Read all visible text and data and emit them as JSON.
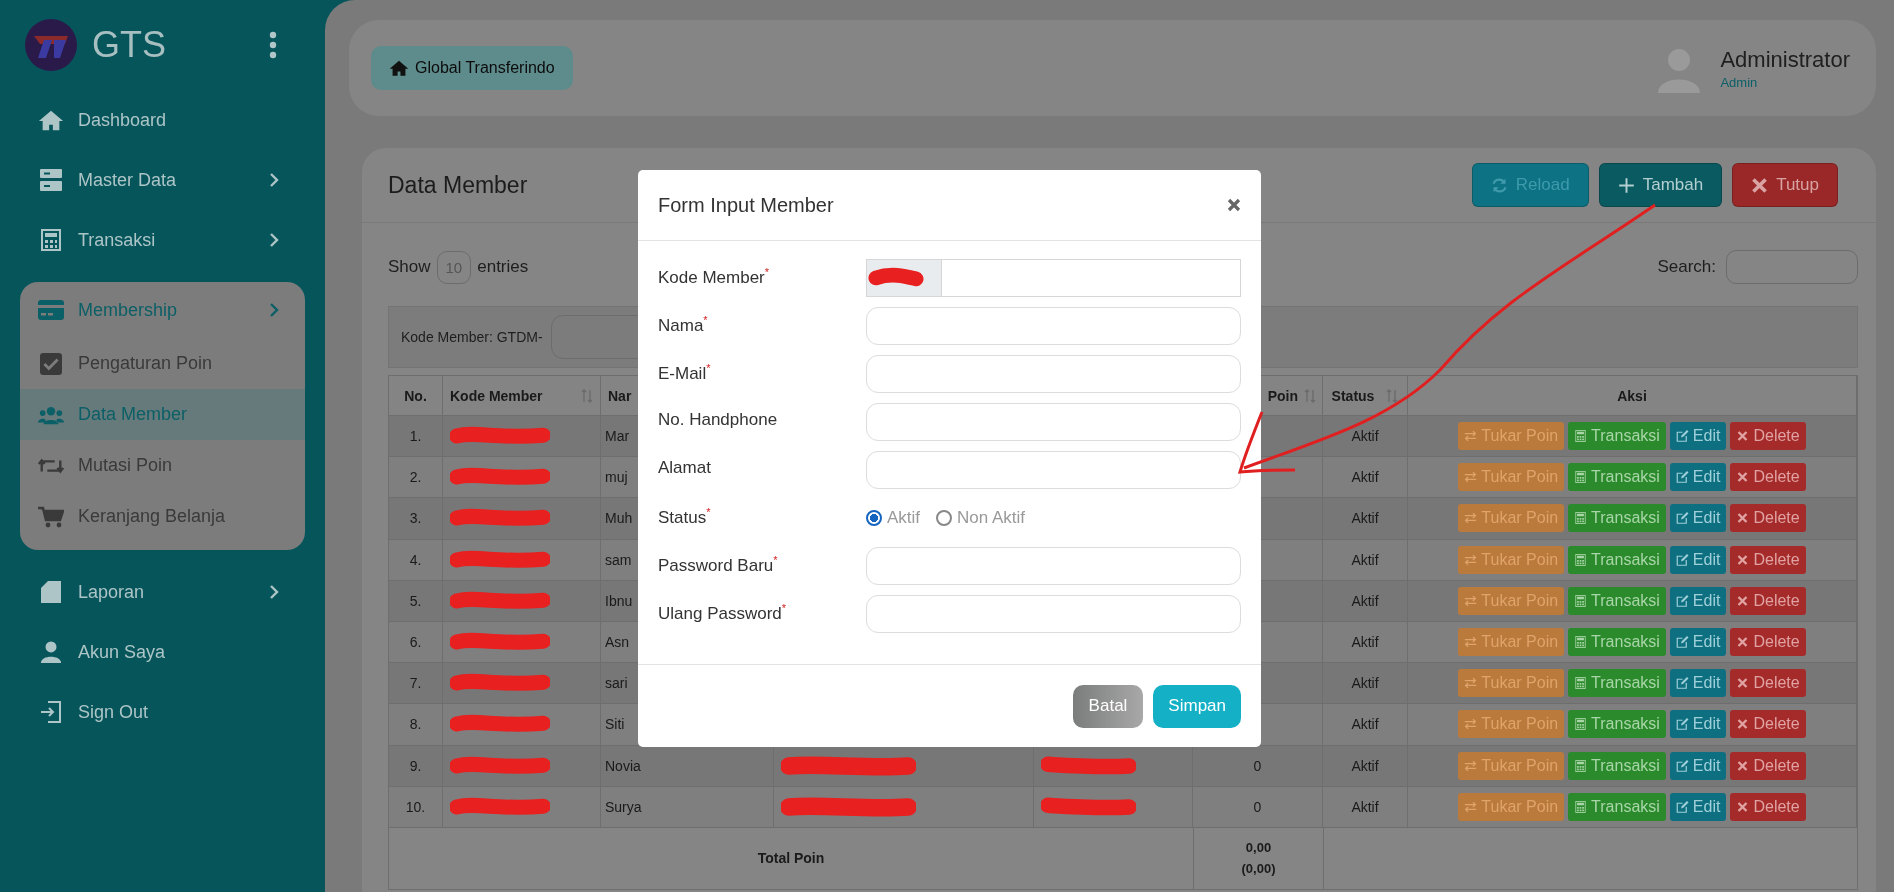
{
  "sidebar": {
    "logo_text": "GTS",
    "items": [
      {
        "label": "Dashboard",
        "submenu": false
      },
      {
        "label": "Master Data",
        "submenu": true
      },
      {
        "label": "Transaksi",
        "submenu": true
      },
      {
        "label": "Membership",
        "submenu": true,
        "expanded": true,
        "children": [
          {
            "label": "Pengaturan Poin",
            "selected": false
          },
          {
            "label": "Data Member",
            "selected": true
          },
          {
            "label": "Mutasi Poin",
            "selected": false
          },
          {
            "label": "Keranjang Belanja",
            "selected": false
          }
        ]
      },
      {
        "label": "Laporan",
        "submenu": true
      },
      {
        "label": "Akun Saya",
        "submenu": false
      },
      {
        "label": "Sign Out",
        "submenu": false
      }
    ]
  },
  "header": {
    "breadcrumb": "Global Transferindo",
    "user": {
      "name": "Administrator",
      "role": "Admin"
    }
  },
  "card": {
    "title": "Data Member",
    "buttons": [
      {
        "kind": "reload",
        "label": "Reload"
      },
      {
        "kind": "add",
        "label": "Tambah"
      },
      {
        "kind": "close",
        "label": "Tutup"
      }
    ]
  },
  "length": {
    "before": "Show",
    "value": "10",
    "after": "entries"
  },
  "search": {
    "label": "Search:"
  },
  "filter": {
    "label": "Kode Member: GTDM-"
  },
  "table": {
    "columns": [
      {
        "label": "No.",
        "sortable": false
      },
      {
        "label": "Kode Member",
        "sortable": true
      },
      {
        "label": "Nar",
        "sortable": false
      },
      {
        "label": "Poin",
        "sortable": true
      },
      {
        "label": "Status",
        "sortable": true
      },
      {
        "label": "Aksi",
        "sortable": false
      }
    ],
    "rows": [
      {
        "no": "1.",
        "nama": "Mar",
        "status": "Aktif",
        "actions": [
          {
            "kind": "exchange",
            "label": "Tukar Poin"
          },
          {
            "kind": "transaction",
            "label": "Transaksi"
          },
          {
            "kind": "edit",
            "label": "Edit"
          },
          {
            "kind": "delete",
            "label": "Delete"
          }
        ]
      },
      {
        "no": "2.",
        "nama": "muj",
        "status": "Aktif",
        "actions": [
          {
            "kind": "exchange",
            "label": "Tukar Poin"
          },
          {
            "kind": "transaction",
            "label": "Transaksi"
          },
          {
            "kind": "edit",
            "label": "Edit"
          },
          {
            "kind": "delete",
            "label": "Delete"
          }
        ]
      },
      {
        "no": "3.",
        "nama": "Muh",
        "status": "Aktif",
        "actions": [
          {
            "kind": "exchange",
            "label": "Tukar Poin"
          },
          {
            "kind": "transaction",
            "label": "Transaksi"
          },
          {
            "kind": "edit",
            "label": "Edit"
          },
          {
            "kind": "delete",
            "label": "Delete"
          }
        ]
      },
      {
        "no": "4.",
        "nama": "sam",
        "status": "Aktif",
        "actions": [
          {
            "kind": "exchange",
            "label": "Tukar Poin"
          },
          {
            "kind": "transaction",
            "label": "Transaksi"
          },
          {
            "kind": "edit",
            "label": "Edit"
          },
          {
            "kind": "delete",
            "label": "Delete"
          }
        ]
      },
      {
        "no": "5.",
        "nama": "Ibnu",
        "status": "Aktif",
        "actions": [
          {
            "kind": "exchange",
            "label": "Tukar Poin"
          },
          {
            "kind": "transaction",
            "label": "Transaksi"
          },
          {
            "kind": "edit",
            "label": "Edit"
          },
          {
            "kind": "delete",
            "label": "Delete"
          }
        ]
      },
      {
        "no": "6.",
        "nama": "Asn",
        "status": "Aktif",
        "actions": [
          {
            "kind": "exchange",
            "label": "Tukar Poin"
          },
          {
            "kind": "transaction",
            "label": "Transaksi"
          },
          {
            "kind": "edit",
            "label": "Edit"
          },
          {
            "kind": "delete",
            "label": "Delete"
          }
        ]
      },
      {
        "no": "7.",
        "nama": "sari",
        "status": "Aktif",
        "actions": [
          {
            "kind": "exchange",
            "label": "Tukar Poin"
          },
          {
            "kind": "transaction",
            "label": "Transaksi"
          },
          {
            "kind": "edit",
            "label": "Edit"
          },
          {
            "kind": "delete",
            "label": "Delete"
          }
        ]
      },
      {
        "no": "8.",
        "nama": "Siti",
        "status": "Aktif",
        "actions": [
          {
            "kind": "exchange",
            "label": "Tukar Poin"
          },
          {
            "kind": "transaction",
            "label": "Transaksi"
          },
          {
            "kind": "edit",
            "label": "Edit"
          },
          {
            "kind": "delete",
            "label": "Delete"
          }
        ]
      },
      {
        "no": "9.",
        "nama": "Novia",
        "poin": "0",
        "status": "Aktif",
        "actions": [
          {
            "kind": "exchange",
            "label": "Tukar Poin"
          },
          {
            "kind": "transaction",
            "label": "Transaksi"
          },
          {
            "kind": "edit",
            "label": "Edit"
          },
          {
            "kind": "delete",
            "label": "Delete"
          }
        ]
      },
      {
        "no": "10.",
        "nama": "Surya",
        "poin": "0",
        "status": "Aktif",
        "actions": [
          {
            "kind": "exchange",
            "label": "Tukar Poin"
          },
          {
            "kind": "transaction",
            "label": "Transaksi"
          },
          {
            "kind": "edit",
            "label": "Edit"
          },
          {
            "kind": "delete",
            "label": "Delete"
          }
        ]
      }
    ],
    "total": {
      "label": "Total Poin",
      "value": "0,00",
      "sub": "(0,00)"
    }
  },
  "modal": {
    "title": "Form Input Member",
    "fields": [
      {
        "label": "Kode Member$^{*}$",
        "kind": "prefixed"
      },
      {
        "label": "Nama$^{*}$",
        "kind": "text"
      },
      {
        "label": "E-Mail$^{*}$",
        "kind": "text"
      },
      {
        "label": "No. Handphone",
        "kind": "text"
      },
      {
        "label": "Alamat",
        "kind": "text"
      },
      {
        "label": "Status$^{*}$",
        "kind": "radio",
        "options": [
          {
            "label": "Aktif",
            "selected": true
          },
          {
            "label": "Non Aktif",
            "selected": false
          }
        ]
      },
      {
        "label": "Password Baru$^{*}$",
        "kind": "text"
      },
      {
        "label": "Ulang Password$^{*}$",
        "kind": "text"
      }
    ],
    "buttons": [
      {
        "kind": "cancel",
        "label": "Batal"
      },
      {
        "kind": "save",
        "label": "Simpan"
      }
    ]
  }
}
